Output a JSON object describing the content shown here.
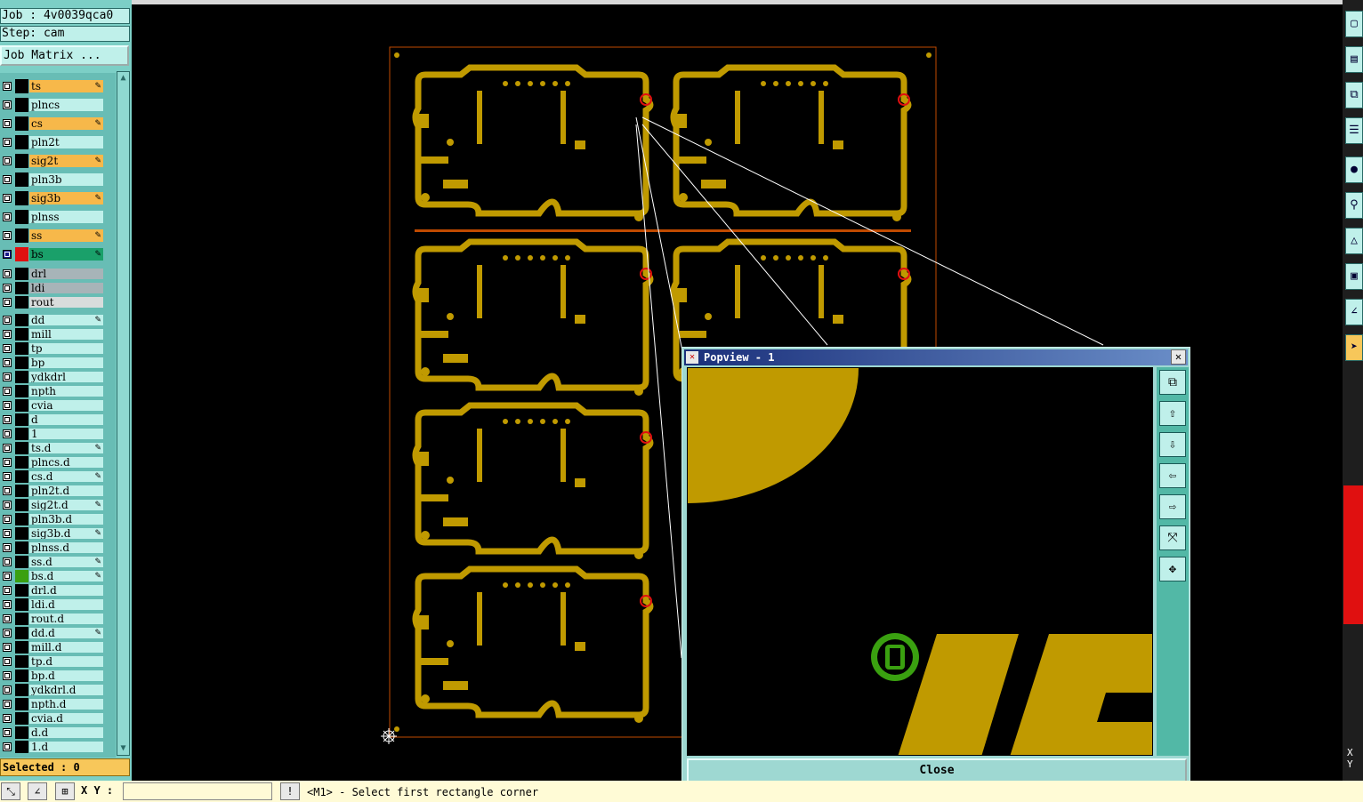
{
  "job": {
    "label": "Job : 4v0039qca0",
    "step": "Step: cam",
    "matrix_button": "Job Matrix ..."
  },
  "layers": [
    {
      "name": "ts",
      "color": "board_sig",
      "marked": true
    },
    {
      "name": "plncs",
      "color": "board"
    },
    {
      "name": "cs",
      "color": "board_sig",
      "marked": true
    },
    {
      "name": "pln2t",
      "color": "board"
    },
    {
      "name": "sig2t",
      "color": "board_sig",
      "marked": true
    },
    {
      "name": "pln3b",
      "color": "board"
    },
    {
      "name": "sig3b",
      "color": "board_sig",
      "marked": true
    },
    {
      "name": "plnss",
      "color": "board"
    },
    {
      "name": "ss",
      "color": "board_sig",
      "marked": true
    },
    {
      "name": "bs",
      "color": "active",
      "marked": true
    },
    {
      "name": "drl",
      "color": "gray"
    },
    {
      "name": "ldi",
      "color": "gray"
    },
    {
      "name": "rout",
      "color": "lgray"
    },
    {
      "name": "dd",
      "marked": true
    },
    {
      "name": "mill"
    },
    {
      "name": "tp"
    },
    {
      "name": "bp"
    },
    {
      "name": "ydkdrl"
    },
    {
      "name": "npth"
    },
    {
      "name": "cvia"
    },
    {
      "name": "d"
    },
    {
      "name": "1"
    },
    {
      "name": "ts.d",
      "marked": true
    },
    {
      "name": "plncs.d"
    },
    {
      "name": "cs.d",
      "marked": true
    },
    {
      "name": "pln2t.d"
    },
    {
      "name": "sig2t.d",
      "marked": true
    },
    {
      "name": "pln3b.d"
    },
    {
      "name": "sig3b.d",
      "marked": true
    },
    {
      "name": "plnss.d"
    },
    {
      "name": "ss.d",
      "marked": true
    },
    {
      "name": "bs.d",
      "marked": true
    },
    {
      "name": "drl.d"
    },
    {
      "name": "ldi.d"
    },
    {
      "name": "rout.d"
    },
    {
      "name": "dd.d",
      "marked": true
    },
    {
      "name": "mill.d"
    },
    {
      "name": "tp.d"
    },
    {
      "name": "bp.d"
    },
    {
      "name": "ydkdrl.d"
    },
    {
      "name": "npth.d"
    },
    {
      "name": "cvia.d"
    },
    {
      "name": "d.d"
    },
    {
      "name": "1.d"
    }
  ],
  "selected": "Selected : 0",
  "bottom": {
    "xy_label": "X Y :",
    "xy_value": "",
    "status": "<M1> - Select first rectangle corner"
  },
  "popview": {
    "title": "Popview - 1",
    "close_button": "Close"
  },
  "right_toolbar": {
    "xy": "X\nY"
  },
  "colors": {
    "copper": "#c09a00",
    "sig_orange": "#f7b84a",
    "teal": "#7ccfc6",
    "green_pad": "#3aa010"
  }
}
